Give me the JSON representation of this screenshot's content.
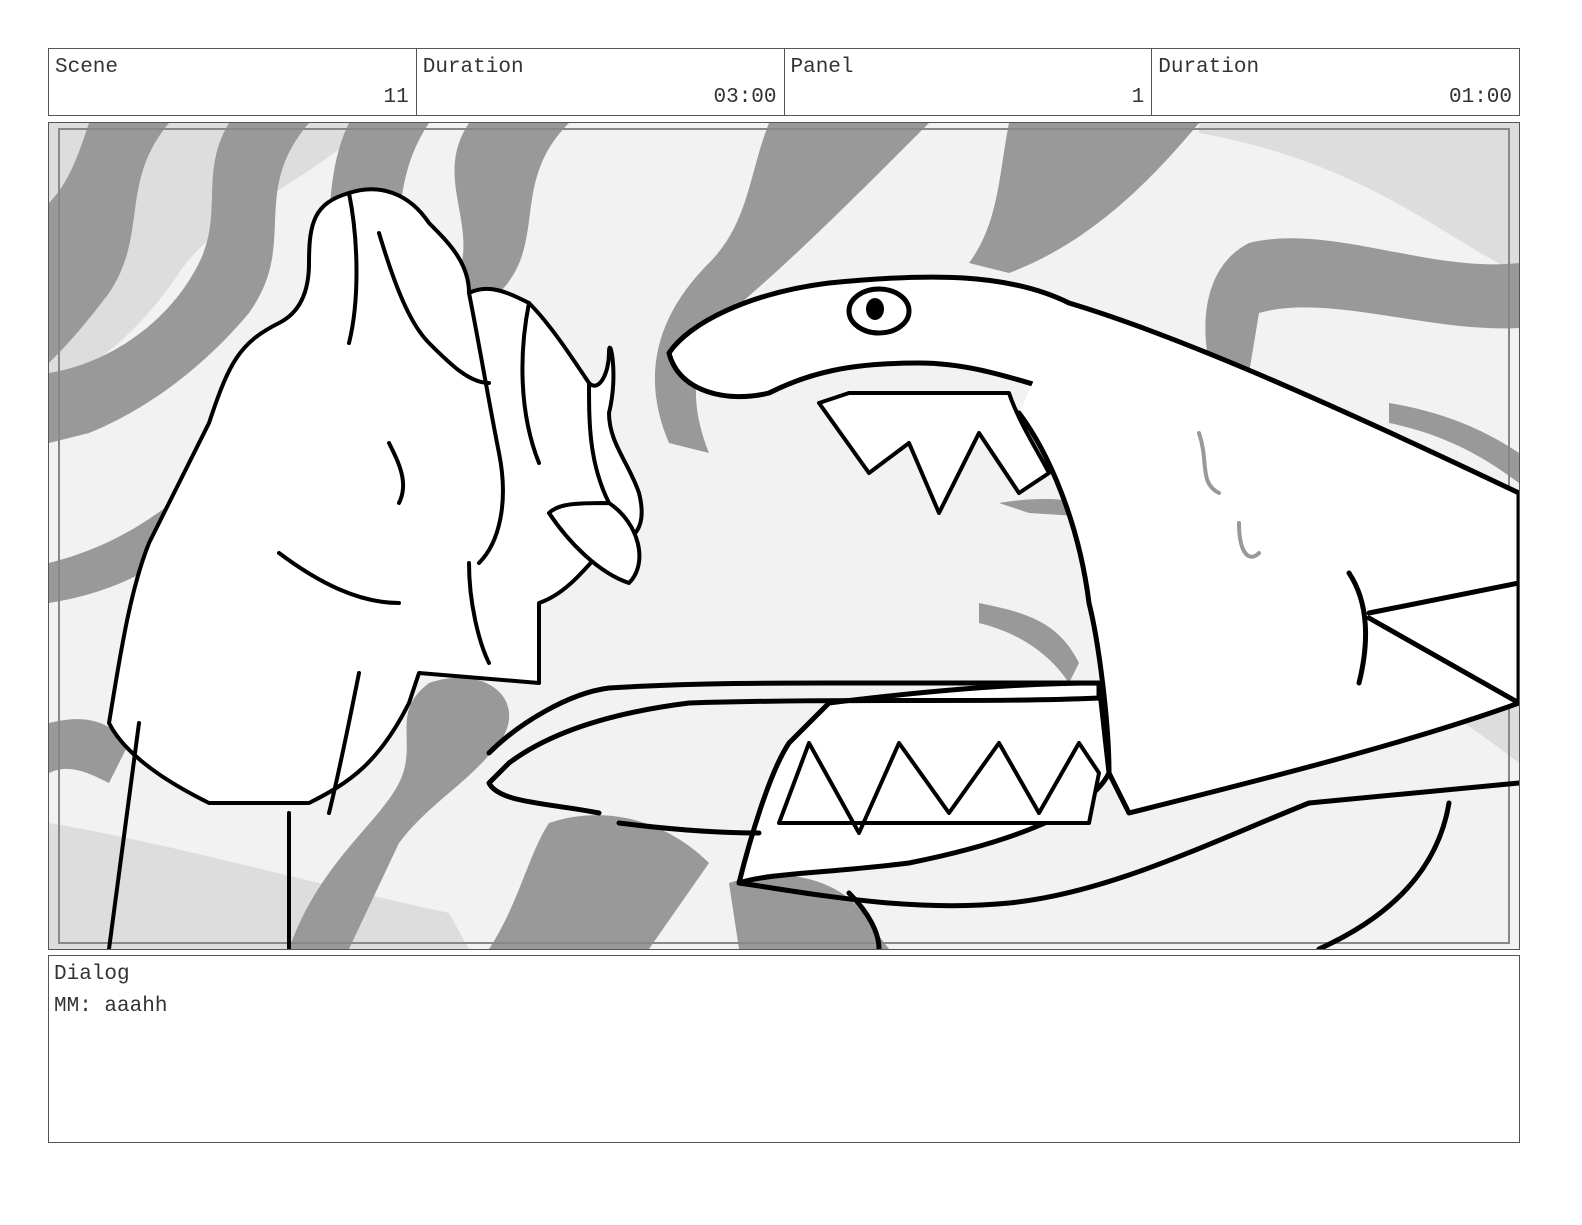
{
  "header": {
    "scene_label": "Scene",
    "scene_value": "11",
    "scene_duration_label": "Duration",
    "scene_duration_value": "03:00",
    "panel_label": "Panel",
    "panel_value": "1",
    "panel_duration_label": "Duration",
    "panel_duration_value": "01:00"
  },
  "dialog": {
    "label": "Dialog",
    "text": "MM: aaahh"
  },
  "colors": {
    "border": "#555555",
    "text": "#333333",
    "swirl_dark": "#999999",
    "swirl_light": "#dddddd",
    "line": "#000000"
  },
  "illustration": {
    "subject_icons": [
      "hand-icon",
      "fish-icon"
    ]
  }
}
